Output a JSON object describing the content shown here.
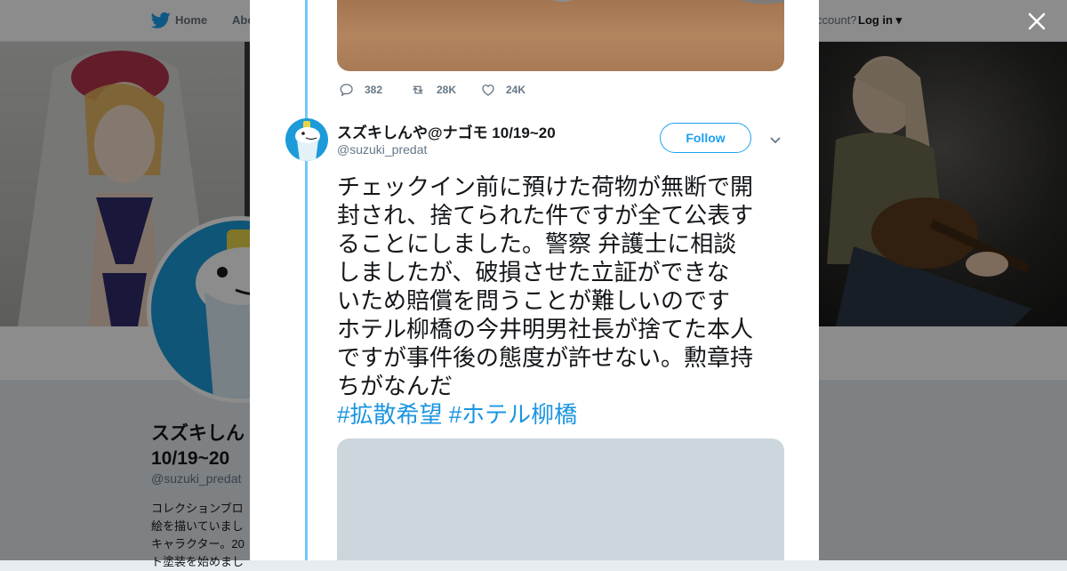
{
  "nav": {
    "home": "Home",
    "about": "Abo",
    "account_prompt": "ccount?",
    "login": "Log in"
  },
  "profile": {
    "name_line1": "スズキしん",
    "name_line2": "10/19~20",
    "handle": "@suzuki_predat",
    "bio_lines": [
      "コレクションブロ",
      "絵を描いていまし",
      "キャラクター。20",
      "ト塗装を始めまし"
    ]
  },
  "tweet_above": {
    "reply_count": "382",
    "retweet_count": "28K",
    "like_count": "24K"
  },
  "tweet": {
    "author_name": "スズキしんや@ナゴモ 10/19~20",
    "author_handle": "@suzuki_predat",
    "follow_label": "Follow",
    "text_lines": [
      "チェックイン前に預けた荷物が無断で開",
      "封され、捨てられた件ですが全て公表す",
      "ることにしました。警察 弁護士に相談",
      "しましたが、破損させた立証ができな",
      "いため賠償を問うことが難しいのです",
      "ホテル柳橋の今井明男社長が捨てた本人",
      "ですが事件後の態度が許せない。勲章持",
      "ちがなんだ"
    ],
    "hashtags": [
      "#拡散希望",
      "#ホテル柳橋"
    ]
  },
  "colors": {
    "accent": "#1da1f2",
    "thread_line": "#71c9f8",
    "avatar_blue": "#1d9bd9"
  },
  "icons": {
    "logo": "twitter-bird-icon",
    "close": "close-icon",
    "reply": "reply-icon",
    "retweet": "retweet-icon",
    "like": "heart-icon",
    "caret": "chevron-down-icon"
  }
}
